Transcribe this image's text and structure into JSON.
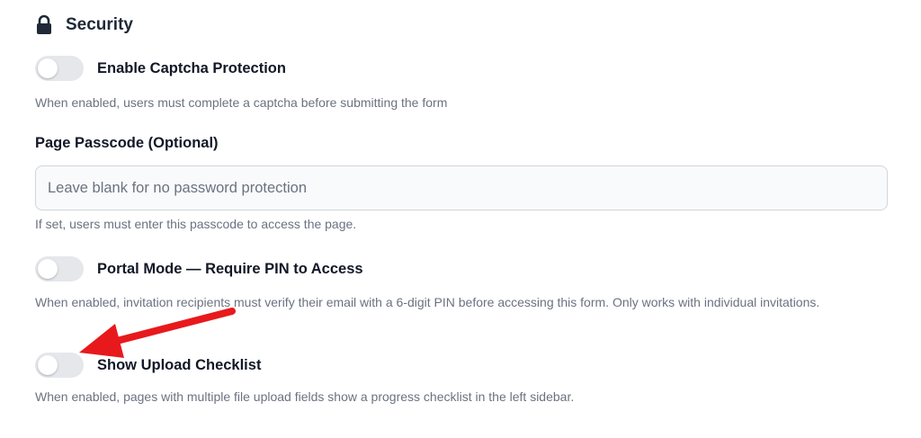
{
  "section": {
    "title": "Security",
    "icon": "lock-icon"
  },
  "captcha": {
    "label": "Enable Captcha Protection",
    "enabled": false,
    "help": "When enabled, users must complete a captcha before submitting the form"
  },
  "passcode": {
    "label": "Page Passcode (Optional)",
    "value": "",
    "placeholder": "Leave blank for no password protection",
    "help": "If set, users must enter this passcode to access the page."
  },
  "portal_mode": {
    "label": "Portal Mode — Require PIN to Access",
    "enabled": false,
    "help": "When enabled, invitation recipients must verify their email with a 6-digit PIN before accessing this form. Only works with individual invitations."
  },
  "upload_checklist": {
    "label": "Show Upload Checklist",
    "enabled": false,
    "help": "When enabled, pages with multiple file upload fields show a progress checklist in the left sidebar."
  },
  "annotation": {
    "arrow_color": "#e8191c",
    "arrow_icon": "red-arrow-annotation"
  },
  "colors": {
    "toggle_off": "#e5e7eb",
    "text_primary": "#111827",
    "text_secondary": "#6b7280"
  }
}
